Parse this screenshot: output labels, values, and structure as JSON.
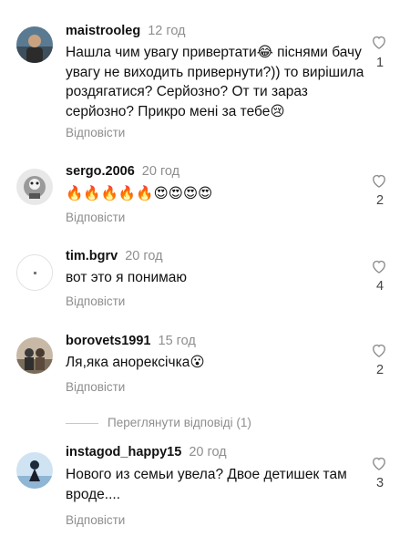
{
  "comments": [
    {
      "username": "maistrooleg",
      "time": "12 год",
      "text": "Нашла чим увагу привертати😂 піснями бачу увагу не виходить привернути?)) то вирішила роздягатися? Серйозно? От ти зараз серйозно? Прикро мені за тебе😢",
      "reply": "Відповісти",
      "likes": "1"
    },
    {
      "username": "sergo.2006",
      "time": "20 год",
      "text": "🔥🔥🔥🔥🔥😍😍😍😍",
      "reply": "Відповісти",
      "likes": "2"
    },
    {
      "username": "tim.bgrv",
      "time": "20 год",
      "text": "вот это я понимаю",
      "reply": "Відповісти",
      "likes": "4"
    },
    {
      "username": "borovets1991",
      "time": "15 год",
      "text": "Ля,яка анорексічка😮",
      "reply": "Відповісти",
      "likes": "2"
    },
    {
      "username": "instagod_happy15",
      "time": "20 год",
      "text": "Нового из семьи увела? Двое детишек там вроде....",
      "reply": "Відповісти",
      "likes": "3"
    }
  ],
  "view_replies": "Переглянути відповіді (1)",
  "colors": {
    "text": "#111111",
    "muted": "#8e8e8e",
    "divider": "#c8c8c8"
  },
  "icons": {
    "like": "heart-outline-icon"
  }
}
